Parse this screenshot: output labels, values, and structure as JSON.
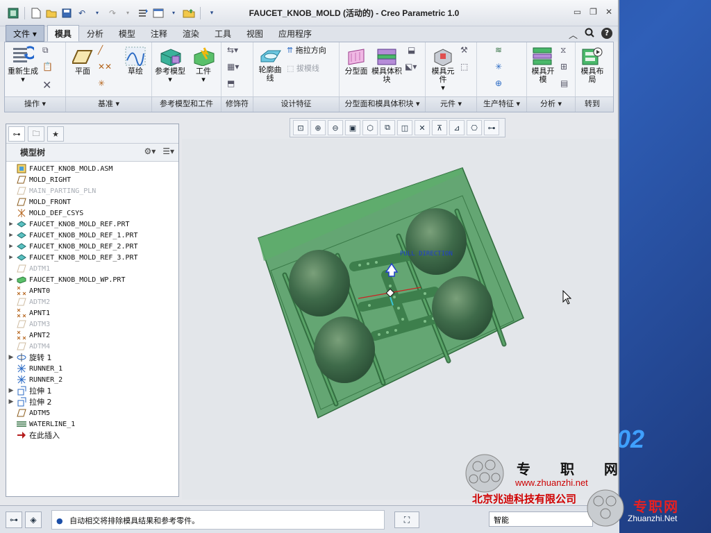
{
  "window": {
    "title": "FAUCET_KNOB_MOLD (活动的) - Creo Parametric 1.0"
  },
  "tabs": [
    "文件",
    "模具",
    "分析",
    "模型",
    "注释",
    "渲染",
    "工具",
    "视图",
    "应用程序"
  ],
  "active_tab": "模具",
  "ribbon": {
    "regenerate": "重新生成",
    "plane": "平面",
    "sketch": "草绘",
    "ref_model": "参考模型",
    "workpiece": "工件",
    "contour_curve": "轮廓曲线",
    "drag_direction": "拖拉方向",
    "draft_line": "拔模线",
    "parting_surface": "分型面",
    "mold_volume": "模具体积块",
    "mold_component": "模具元件",
    "mold_open": "模具开模",
    "mold_layout": "模具布局",
    "groups": [
      "操作",
      "基准",
      "参考模型和工件",
      "修饰符",
      "设计特征",
      "分型面和模具体积块",
      "元件",
      "生产特征",
      "分析",
      "转到"
    ]
  },
  "model_tree": {
    "header": "模型树",
    "items": [
      {
        "label": "FAUCET_KNOB_MOLD.ASM",
        "icon": "assembly-icon",
        "dim": false,
        "expand": false
      },
      {
        "label": "MOLD_RIGHT",
        "icon": "datum-plane-icon",
        "dim": false,
        "expand": false
      },
      {
        "label": "MAIN_PARTING_PLN",
        "icon": "datum-plane-icon",
        "dim": true,
        "expand": false
      },
      {
        "label": "MOLD_FRONT",
        "icon": "datum-plane-icon",
        "dim": false,
        "expand": false
      },
      {
        "label": "MOLD_DEF_CSYS",
        "icon": "csys-icon",
        "dim": false,
        "expand": false
      },
      {
        "label": "FAUCET_KNOB_MOLD_REF.PRT",
        "icon": "part-icon",
        "dim": false,
        "expand": true
      },
      {
        "label": "FAUCET_KNOB_MOLD_REF_1.PRT",
        "icon": "part-icon",
        "dim": false,
        "expand": true
      },
      {
        "label": "FAUCET_KNOB_MOLD_REF_2.PRT",
        "icon": "part-icon",
        "dim": false,
        "expand": true
      },
      {
        "label": "FAUCET_KNOB_MOLD_REF_3.PRT",
        "icon": "part-icon",
        "dim": false,
        "expand": true
      },
      {
        "label": "ADTM1",
        "icon": "datum-plane-icon",
        "dim": true,
        "expand": false
      },
      {
        "label": "FAUCET_KNOB_MOLD_WP.PRT",
        "icon": "workpiece-icon",
        "dim": false,
        "expand": true
      },
      {
        "label": "APNT0",
        "icon": "point-icon",
        "dim": false,
        "expand": false
      },
      {
        "label": "ADTM2",
        "icon": "datum-plane-icon",
        "dim": true,
        "expand": false
      },
      {
        "label": "APNT1",
        "icon": "point-icon",
        "dim": false,
        "expand": false
      },
      {
        "label": "ADTM3",
        "icon": "datum-plane-icon",
        "dim": true,
        "expand": false
      },
      {
        "label": "APNT2",
        "icon": "point-icon",
        "dim": false,
        "expand": false
      },
      {
        "label": "ADTM4",
        "icon": "datum-plane-icon",
        "dim": true,
        "expand": false
      },
      {
        "label": "旋转 1",
        "icon": "revolve-icon",
        "dim": false,
        "expand": true
      },
      {
        "label": "RUNNER_1",
        "icon": "runner-icon",
        "dim": false,
        "expand": false
      },
      {
        "label": "RUNNER_2",
        "icon": "runner-icon",
        "dim": false,
        "expand": false
      },
      {
        "label": "拉伸 1",
        "icon": "extrude-icon",
        "dim": false,
        "expand": true
      },
      {
        "label": "拉伸 2",
        "icon": "extrude-icon",
        "dim": false,
        "expand": true
      },
      {
        "label": "ADTM5",
        "icon": "datum-plane-icon",
        "dim": false,
        "expand": false
      },
      {
        "label": "WATERLINE_1",
        "icon": "waterline-icon",
        "dim": false,
        "expand": false
      },
      {
        "label": "在此插入",
        "icon": "insert-here-icon",
        "dim": false,
        "expand": false
      }
    ]
  },
  "viewport": {
    "pull_direction_label": "PULL DIRECTION"
  },
  "status": {
    "message": "自动相交将排除模具结果和参考零件。",
    "filter": "智能"
  },
  "watermark": {
    "site_cn": "专 职 网",
    "site_url": "www.zhuanzhi.net",
    "company": "北京兆迪科技有限公司",
    "brand_cn": "专职网",
    "brand_url": "Zhuanzhi.Net",
    "corner_number": "02"
  }
}
